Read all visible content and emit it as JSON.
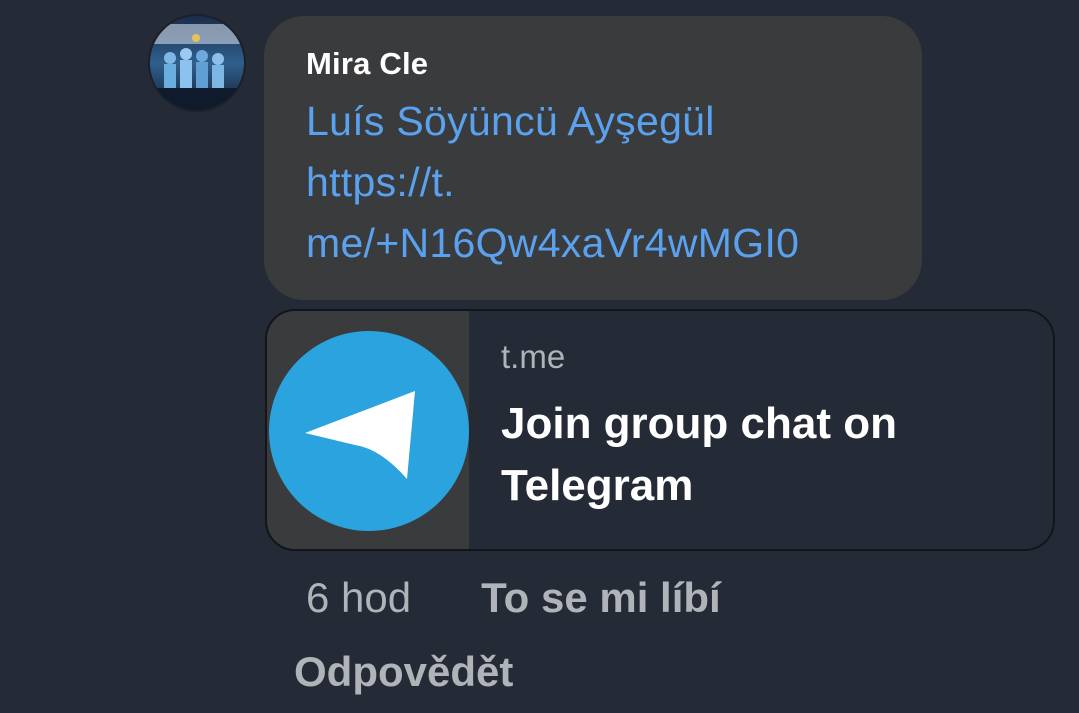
{
  "comment": {
    "author": "Mira Cle",
    "message_lines": [
      "Luís Söyüncü Ayşegül",
      "https://t.",
      "me/+N16Qw4xaVr4wMGI0"
    ]
  },
  "link_preview": {
    "domain": "t.me",
    "title": "Join group chat on Telegram",
    "icon": "telegram-logo-icon"
  },
  "actions": {
    "timestamp": "6 hod",
    "like_label": "To se mi líbí",
    "reply_label": "Odpovědět"
  },
  "colors": {
    "background": "#242a36",
    "bubble": "#3a3b3d",
    "link": "#5aa2ef",
    "muted": "#b0b3b8",
    "telegram_blue": "#2aa3df"
  }
}
